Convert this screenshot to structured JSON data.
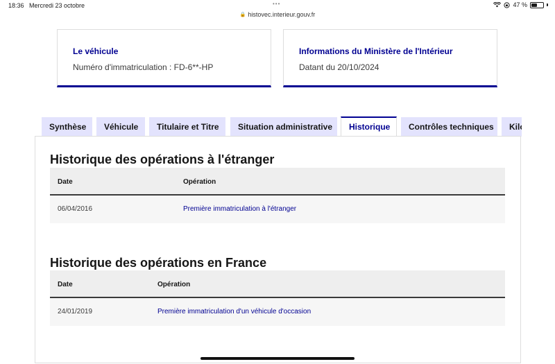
{
  "statusbar": {
    "time": "18:36",
    "date": "Mercredi 23 octobre",
    "battery": "47 %",
    "battery_level": 0.47
  },
  "browser": {
    "url": "histovec.interieur.gouv.fr"
  },
  "cards": [
    {
      "title": "Le véhicule",
      "text": "Numéro d'immatriculation : FD-6**-HP"
    },
    {
      "title": "Informations du Ministère de l'Intérieur",
      "text": "Datant du 20/10/2024"
    }
  ],
  "tabs": [
    {
      "label": "Synthèse"
    },
    {
      "label": "Véhicule"
    },
    {
      "label": "Titulaire et Titre"
    },
    {
      "label": "Situation administrative"
    },
    {
      "label": "Historique",
      "active": true
    },
    {
      "label": "Contrôles techniques"
    },
    {
      "label": "Kilométrage"
    }
  ],
  "sections": [
    {
      "title": "Historique des opérations à l'étranger",
      "columns": [
        "Date",
        "Opération"
      ],
      "rows": [
        {
          "date": "06/04/2016",
          "operation": "Première immatriculation à l'étranger"
        }
      ]
    },
    {
      "title": "Historique des opérations en France",
      "columns": [
        "Date",
        "Opération"
      ],
      "rows": [
        {
          "date": "24/01/2019",
          "operation": "Première immatriculation d'un véhicule d'occasion"
        }
      ]
    }
  ],
  "colors": {
    "accent": "#000091",
    "tab_background": "#e3e3fd"
  }
}
